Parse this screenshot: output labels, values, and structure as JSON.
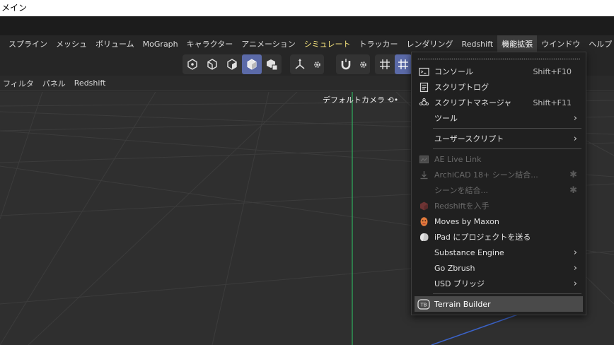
{
  "window": {
    "title": "メイン"
  },
  "menubar": {
    "items": [
      {
        "label": "スプライン",
        "state": "normal"
      },
      {
        "label": "メッシュ",
        "state": "normal"
      },
      {
        "label": "ボリューム",
        "state": "normal"
      },
      {
        "label": "MoGraph",
        "state": "normal"
      },
      {
        "label": "キャラクター",
        "state": "normal"
      },
      {
        "label": "アニメーション",
        "state": "normal"
      },
      {
        "label": "シミュレート",
        "state": "highlight"
      },
      {
        "label": "トラッカー",
        "state": "normal"
      },
      {
        "label": "レンダリング",
        "state": "normal"
      },
      {
        "label": "Redshift",
        "state": "normal"
      },
      {
        "label": "機能拡張",
        "state": "active"
      },
      {
        "label": "ウインドウ",
        "state": "normal"
      },
      {
        "label": "ヘルプ",
        "state": "normal"
      }
    ]
  },
  "toolbar": {
    "icons": [
      "points-mode-icon",
      "edges-mode-icon",
      "polygons-mode-icon",
      "model-mode-icon",
      "texture-mode-icon",
      "axis-icon",
      "axis-settings-gear-icon",
      "snap-magnet-icon",
      "snap-settings-gear-icon",
      "grid-icon",
      "workplane-grid-icon"
    ],
    "selected": "model-mode-icon"
  },
  "subbar": {
    "items": [
      "フィルタ",
      "パネル",
      "Redshift"
    ]
  },
  "viewport": {
    "camera_label": "デフォルトカメラ ⟲•"
  },
  "popup_menu": {
    "items": [
      {
        "label": "コンソール",
        "shortcut": "Shift+F10",
        "icon": "console-icon",
        "state": "normal"
      },
      {
        "label": "スクリプトログ",
        "shortcut": "",
        "icon": "script-log-icon",
        "state": "normal"
      },
      {
        "label": "スクリプトマネージャ",
        "shortcut": "Shift+F11",
        "icon": "script-manager-icon",
        "state": "normal"
      },
      {
        "label": "ツール",
        "shortcut": "",
        "icon": "",
        "state": "submenu"
      },
      {
        "label": "ユーザースクリプト",
        "shortcut": "",
        "icon": "",
        "state": "submenu"
      },
      {
        "label": "AE Live Link",
        "shortcut": "",
        "icon": "ae-live-link-icon",
        "state": "disabled"
      },
      {
        "label": "ArchiCAD 18+ シーン結合...",
        "shortcut": "",
        "icon": "archicad-download-icon",
        "state": "disabled-gear"
      },
      {
        "label": "シーンを結合...",
        "shortcut": "",
        "icon": "",
        "state": "disabled-gear"
      },
      {
        "label": "Redshiftを入手",
        "shortcut": "",
        "icon": "redshift-cube-icon",
        "state": "disabled"
      },
      {
        "label": "Moves by Maxon",
        "shortcut": "",
        "icon": "moves-face-icon",
        "state": "normal"
      },
      {
        "label": "iPad にプロジェクトを送る",
        "shortcut": "",
        "icon": "ipad-send-icon",
        "state": "normal"
      },
      {
        "label": "Substance Engine",
        "shortcut": "",
        "icon": "",
        "state": "submenu"
      },
      {
        "label": "Go Zbrush",
        "shortcut": "",
        "icon": "",
        "state": "submenu"
      },
      {
        "label": "USD ブリッジ",
        "shortcut": "",
        "icon": "",
        "state": "submenu"
      },
      {
        "label": "Terrain Builder",
        "shortcut": "",
        "icon": "terrain-builder-tb-icon",
        "state": "hover"
      }
    ],
    "submenu_glyph": "›",
    "gear_glyph": "✱"
  },
  "colors": {
    "menubar_bg": "#262626",
    "highlight_text": "#f5e37c",
    "selected_tool": "#5b6aa8",
    "y_axis": "#2fae5e",
    "x_axis": "#3b63c9"
  }
}
